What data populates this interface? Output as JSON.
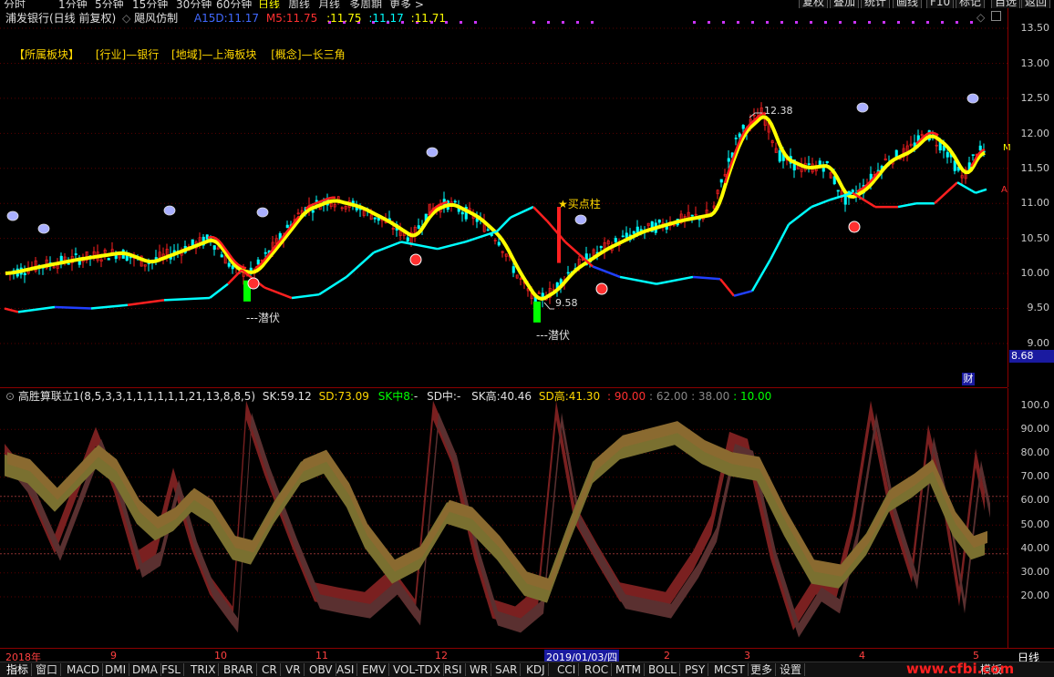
{
  "toolbar": {
    "periods": [
      "分时",
      "1分钟",
      "5分钟",
      "15分钟",
      "30分钟",
      "60分钟",
      "日线",
      "周线",
      "月线",
      "多周期",
      "更多 >"
    ],
    "active_period": "日线",
    "right_buttons": [
      "复权",
      "叠加",
      "统计",
      "画线",
      "F10",
      "标记",
      "自选",
      "返回"
    ]
  },
  "main": {
    "stock_name": "浦发银行(日线 前复权)",
    "indicator_name": "飓风仿制",
    "a15d_label": "A15D:",
    "a15d_value": "11.17",
    "m5_label": "M5:",
    "m5_value": "11.75",
    "v3": ":11.75",
    "v4": ":11.17",
    "v5": ":11.71",
    "sectors": [
      "【所属板块】",
      "[行业]—银行",
      "[地域]—上海板块",
      "[概念]—长三角"
    ],
    "annot_high": "12.38",
    "annot_low": "9.58",
    "buy_label": "★买点柱",
    "hide1": "---潜伏",
    "hide2": "---潜伏",
    "right_labels": {
      "m": "M",
      "a": "A"
    },
    "price_ticks": [
      "13.50",
      "13.00",
      "12.50",
      "12.00",
      "11.50",
      "11.00",
      "10.50",
      "10.00",
      "9.50",
      "9.00"
    ],
    "price_box": "8.68",
    "cai": "财"
  },
  "indicator": {
    "name": "高胜算联立1(8,5,3,3,1,1,1,1,1,1,21,13,8,8,5)",
    "sk_label": "SK:",
    "sk": "59.12",
    "sd_label": "SD:",
    "sd": "73.09",
    "sk_mid": "SK中8:",
    "sk_mid_val": "-",
    "sd_mid": "SD中:",
    "sd_mid_val": "-",
    "sk_high_label": "SK高:",
    "sk_high": "40.46",
    "sd_high_label": "SD高:",
    "sd_high": "41.30",
    "c90": ": 90.00",
    "c62": ": 62.00",
    "c38": ": 38.00",
    "c10": ": 10.00",
    "ticks": [
      "100.0",
      "90.00",
      "80.00",
      "70.00",
      "60.00",
      "50.00",
      "40.00",
      "30.00",
      "20.00"
    ]
  },
  "date_axis": {
    "labels": [
      "2018年",
      "9",
      "10",
      "11",
      "12",
      "2019/01/03/四",
      "2",
      "3",
      "4",
      "5"
    ],
    "period": "日线"
  },
  "tabs": [
    "指标",
    "窗口",
    "MACD",
    "DMI",
    "DMA",
    "FSL",
    "TRIX",
    "BRAR",
    "CR",
    "VR",
    "OBV",
    "ASI",
    "EMV",
    "VOL-TDX",
    "RSI",
    "WR",
    "SAR",
    "KDJ",
    "CCI",
    "ROC",
    "MTM",
    "BOLL",
    "PSY",
    "MCST",
    "更多",
    "设置"
  ],
  "tab_right": "模板",
  "watermark": "www.cfbi.com",
  "colors": {
    "up": "#ff2020",
    "down": "#00ffff",
    "ma_yellow": "#ffff00",
    "ma_red": "#ff0000",
    "ma_cyan": "#40e0ff",
    "axis_red": "#8b0000"
  }
}
